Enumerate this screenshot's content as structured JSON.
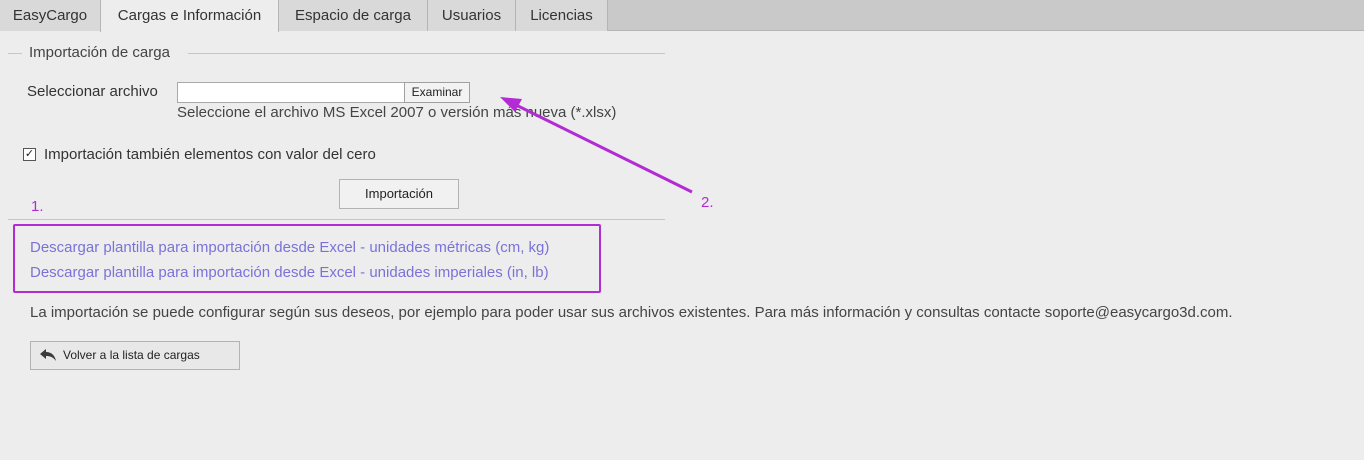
{
  "tabs": [
    {
      "label": "EasyCargo"
    },
    {
      "label": "Cargas e Información"
    },
    {
      "label": "Espacio de carga"
    },
    {
      "label": "Usuarios"
    },
    {
      "label": "Licencias"
    }
  ],
  "import_section": {
    "legend": "Importación de carga",
    "file_label": "Seleccionar archivo",
    "file_value": "",
    "browse_label": "Examinar",
    "hint": "Seleccione el archivo MS Excel 2007 o versión más nueva (*.xlsx)",
    "zero_checkbox_mark": "✓",
    "zero_checkbox_label": "Importación también elementos con valor del cero",
    "import_button": "Importación"
  },
  "annotations": {
    "marker_1": "1.",
    "marker_2": "2.",
    "color": "#b32bd4"
  },
  "template_links": {
    "metric": "Descargar plantilla para importación desde Excel - unidades métricas (cm, kg)",
    "imperial": "Descargar plantilla para importación desde Excel - unidades imperiales (in, lb)"
  },
  "info_text": "La importación se puede configurar según sus deseos, por ejemplo para poder usar sus archivos existentes. Para más información y consultas contacte soporte@easycargo3d.com.",
  "back_button": {
    "label": "Volver a la lista de cargas",
    "icon": "back-arrow-icon"
  },
  "colors": {
    "link": "#7a72d8",
    "background": "#ededed",
    "tabbar": "#c9c9c9"
  }
}
